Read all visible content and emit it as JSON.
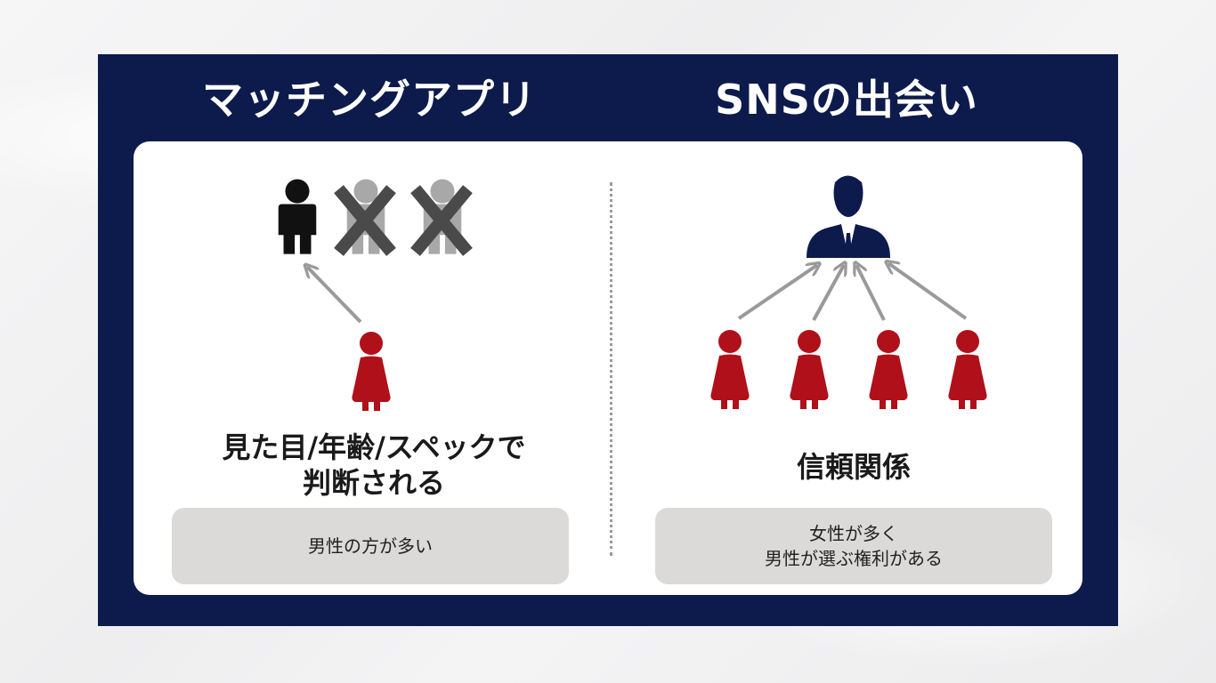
{
  "left": {
    "heading": "マッチングアプリ",
    "statement_lines": [
      "見た目/年齢/スペックで",
      "判断される"
    ],
    "note_lines": [
      "男性の方が多い"
    ]
  },
  "right": {
    "heading": "SNSの出会い",
    "statement_lines": [
      "信頼関係"
    ],
    "note_lines": [
      "女性が多く",
      "男性が選ぶ権利がある"
    ]
  },
  "colors": {
    "frame": "#0d1b4c",
    "woman": "#b0101a",
    "man_selected": "#111111",
    "man_rejected": "#a8a8a8",
    "cross": "#4a4a4a",
    "businessman": "#0d1b4c",
    "arrow": "#9a9a9a",
    "note_bg": "#dcd9d9"
  },
  "icons": {
    "selected_man": "person-icon",
    "rejected_man": "person-crossed-icon",
    "woman": "woman-icon",
    "businessman": "businessman-icon",
    "arrow": "arrow-icon"
  }
}
